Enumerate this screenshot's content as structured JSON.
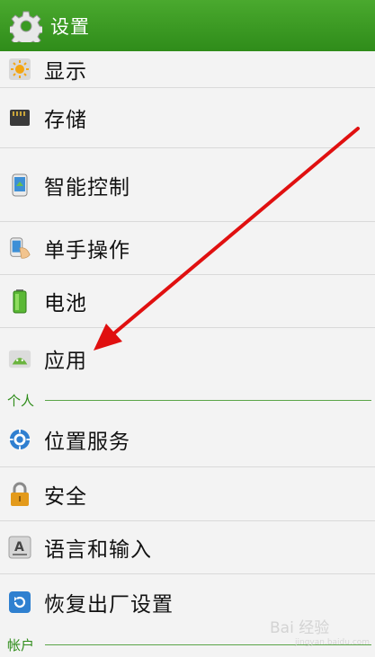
{
  "header": {
    "title": "设置",
    "icon": "gear-icon"
  },
  "items": [
    {
      "label": "显示",
      "icon": "brightness-icon"
    },
    {
      "label": "存储",
      "icon": "sd-card-icon"
    },
    {
      "label": "智能控制",
      "icon": "smart-control-icon"
    },
    {
      "label": "单手操作",
      "icon": "one-hand-icon"
    },
    {
      "label": "电池",
      "icon": "battery-icon"
    },
    {
      "label": "应用",
      "icon": "android-app-icon"
    },
    {
      "label": "位置服务",
      "icon": "location-icon"
    },
    {
      "label": "安全",
      "icon": "lock-icon"
    },
    {
      "label": "语言和输入",
      "icon": "keyboard-icon"
    },
    {
      "label": "恢复出厂设置",
      "icon": "restore-icon"
    }
  ],
  "sections": [
    {
      "label": "个人"
    },
    {
      "label": "帐户"
    }
  ],
  "watermark": {
    "text": "Bai 经验",
    "sub": "jingyan.baidu.com"
  },
  "colors": {
    "header": "#3a9a22",
    "section": "#2f8c1a",
    "arrow": "#e01010"
  }
}
